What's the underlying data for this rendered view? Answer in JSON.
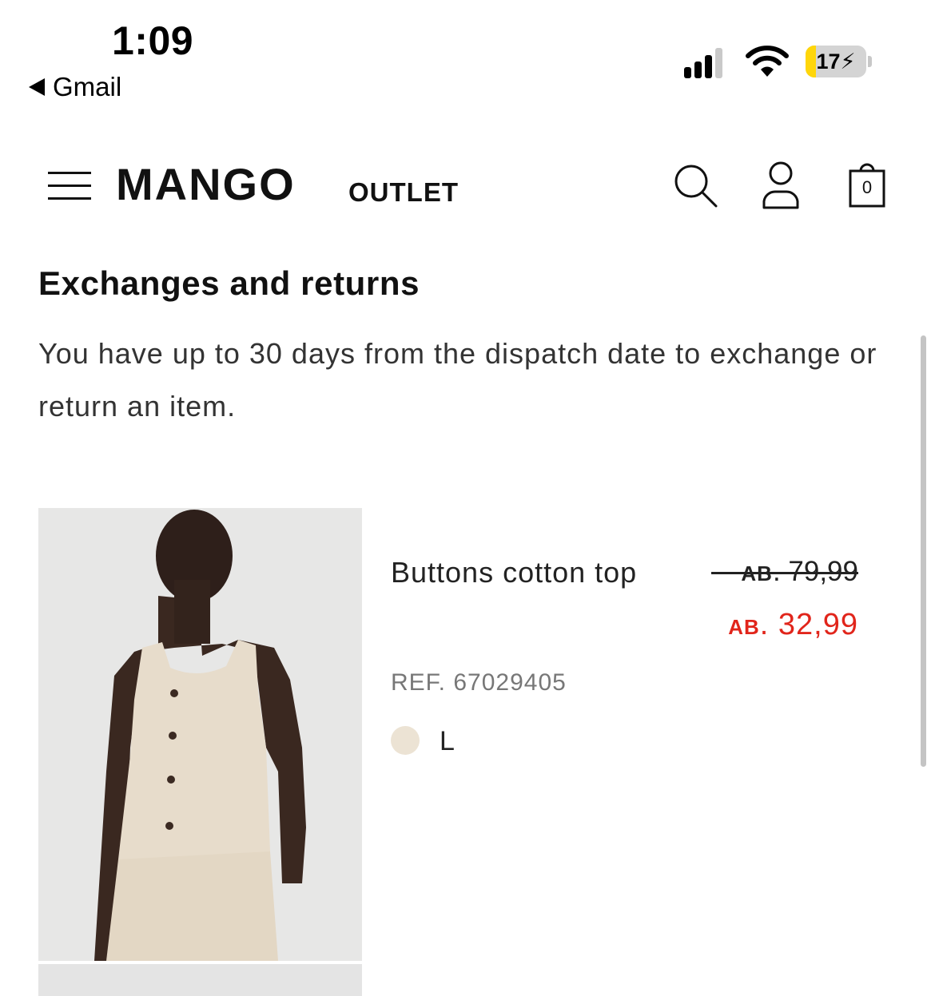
{
  "status_bar": {
    "time": "1:09",
    "back_app": "Gmail",
    "battery_percent": 17,
    "battery_label": "17",
    "charging": true,
    "battery_color": "#ffd60a",
    "signal_bars": 3,
    "signal_icon": "cellular-signal-icon",
    "wifi_icon": "wifi-icon"
  },
  "header": {
    "logo": "MANGO",
    "logo_suffix": "OUTLET",
    "menu_icon": "hamburger-menu-icon",
    "search_icon": "search-icon",
    "account_icon": "user-icon",
    "bag_icon": "shopping-bag-icon",
    "bag_count": "0"
  },
  "returns": {
    "title": "Exchanges and returns",
    "description": "You have up to 30 days from the dispatch date to exchange or return an item."
  },
  "product": {
    "name": "Buttons cotton top",
    "currency": "AB",
    "old_price": ". 79,99",
    "new_price": ". 32,99",
    "ref": "REF. 67029405",
    "size": "L",
    "swatch_color": "#ece3d4",
    "sale_color": "#e1251b"
  }
}
